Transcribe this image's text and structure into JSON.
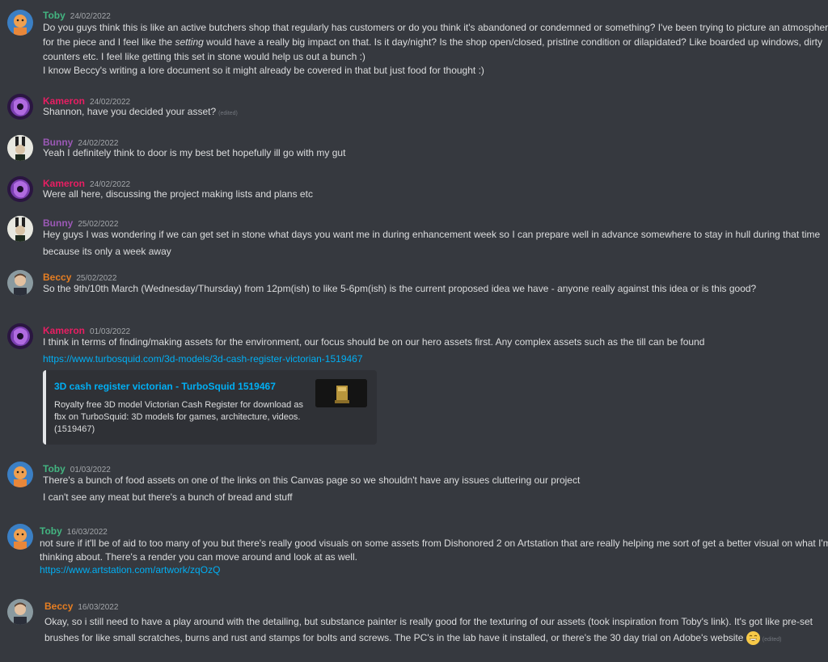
{
  "colors": {
    "toby": "#43b581",
    "kameron": "#e91e63",
    "bunny": "#9b59b6",
    "beccy": "#e67e22",
    "link": "#00aff4",
    "background": "#36393f"
  },
  "messages": [
    {
      "author": "Toby",
      "timestamp": "24/02/2022",
      "avatar_icon": "toby-avatar-icon",
      "lines": [
        "Do you guys think this is like an active butchers shop that regularly has customers or do you think it's abandoned or condemned or something? I've been trying to picture an atmosphere",
        "for the piece and I feel like the",
        "setting",
        "would have a really big impact on that. Is it day/night? Is the shop open/closed, pristine condition or dilapidated? Like boarded up windows, dirty",
        "counters etc. I feel like getting this set in stone would help us out a bunch :)",
        "I know Beccy's writing a lore document so it might already be covered in that but just food for thought :)"
      ]
    },
    {
      "author": "Kameron",
      "timestamp": "24/02/2022",
      "lines": [
        "Shannon, have you decided your asset?"
      ],
      "edited": "(edited)"
    },
    {
      "author": "Bunny",
      "timestamp": "24/02/2022",
      "lines": [
        "Yeah I definitely think to door is my best bet hopefully ill go with my gut"
      ]
    },
    {
      "author": "Kameron",
      "timestamp": "24/02/2022",
      "lines": [
        "Were all here, discussing the project making lists and plans etc"
      ]
    },
    {
      "author": "Bunny",
      "timestamp": "25/02/2022",
      "lines": [
        "Hey guys I was wondering if we can get set in stone what days you want me in during enhancement week so I can prepare well in advance somewhere to stay in hull during that time",
        "because its only a week away"
      ]
    },
    {
      "author": "Beccy",
      "timestamp": "25/02/2022",
      "lines": [
        "So the 9th/10th March (Wednesday/Thursday) from 12pm(ish) to like 5-6pm(ish) is the current proposed idea we have - anyone really against this idea or is this good?"
      ]
    },
    {
      "author": "Kameron",
      "timestamp": "01/03/2022",
      "lines": [
        "I think in terms of finding/making assets for the environment, our focus should be on our hero assets first. Any complex assets such as the till can be found"
      ],
      "link": "https://www.turbosquid.com/3d-models/3d-cash-register-victorian-1519467",
      "embed": {
        "title": "3D cash register victorian - TurboSquid 1519467",
        "description": "Royalty free 3D model Victorian Cash Register for download as fbx on TurboSquid: 3D models for games, architecture, videos. (1519467)"
      }
    },
    {
      "author": "Toby",
      "timestamp": "01/03/2022",
      "lines": [
        "There's a bunch of food assets on one of the links on this Canvas page so we shouldn't have any issues cluttering our project",
        "I can't see any meat but there's a bunch of bread and stuff"
      ]
    },
    {
      "author": "Toby",
      "timestamp": "16/03/2022",
      "lines": [
        "not sure if it'll be of aid to too many of you but there's really good visuals on some assets from Dishonored 2 on Artstation that are really helping me sort of get a better visual on what I'm",
        "thinking about. There's a render you can move around and look at as well."
      ],
      "link": "https://www.artstation.com/artwork/zqOzQ"
    },
    {
      "author": "Beccy",
      "timestamp": "16/03/2022",
      "lines": [
        "Okay, so i still need to have a play around with the detailing, but substance painter is really good for the texturing of our assets (took inspiration from Toby's link). It's got like pre-set",
        "brushes for like small scratches, burns and rust and stamps for bolts and screws. The PC's in the lab have it installed, or there's the 30 day trial on Adobe's website"
      ],
      "emoji": "grinning-emoji-icon",
      "edited": "(edited)"
    }
  ]
}
